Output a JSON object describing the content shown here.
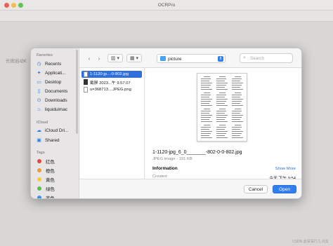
{
  "window": {
    "title": "OCRPro"
  },
  "background": {
    "hint": "长按启动€",
    "watermark": "CSDN @深深行几 刈夂"
  },
  "sidebar": {
    "favorites_label": "Favorites",
    "favorites": [
      {
        "label": "Recents",
        "icon": "clock-icon"
      },
      {
        "label": "Applicati...",
        "icon": "applications-icon"
      },
      {
        "label": "Desktop",
        "icon": "desktop-icon"
      },
      {
        "label": "Documents",
        "icon": "document-icon"
      },
      {
        "label": "Downloads",
        "icon": "download-icon"
      },
      {
        "label": "liquiduimac",
        "icon": "home-icon"
      }
    ],
    "icloud_label": "iCloud",
    "icloud": [
      {
        "label": "iCloud Dri...",
        "icon": "cloud-icon"
      },
      {
        "label": "Shared",
        "icon": "shared-folder-icon"
      }
    ],
    "tags_label": "Tags",
    "tags": [
      {
        "label": "红色",
        "color": "#e5483d"
      },
      {
        "label": "橙色",
        "color": "#f29a38"
      },
      {
        "label": "黄色",
        "color": "#f4cd3b"
      },
      {
        "label": "绿色",
        "color": "#5cc04f"
      },
      {
        "label": "蓝色",
        "color": "#3c8ef0"
      }
    ]
  },
  "toolbar": {
    "back_icon": "chevron-left-icon",
    "forward_icon": "chevron-right-icon",
    "location": "picture",
    "search_placeholder": "Search"
  },
  "files": [
    {
      "name": "1-1120-jp...-0-802.jpg",
      "selected": true
    },
    {
      "name": "截屏 2023...午 9.57.07",
      "selected": false
    },
    {
      "name": "u=368713....JPEG.png",
      "selected": false
    }
  ],
  "preview": {
    "title": "1-1120-jpg_6_0_______-802-0-0-802.jpg",
    "subtitle": "JPEG image - 191 KB",
    "info_label": "Information",
    "show_more": "Show More",
    "created_label": "Created",
    "created_value": "今天 下午 9:54"
  },
  "buttons": {
    "cancel": "Cancel",
    "open": "Open"
  }
}
